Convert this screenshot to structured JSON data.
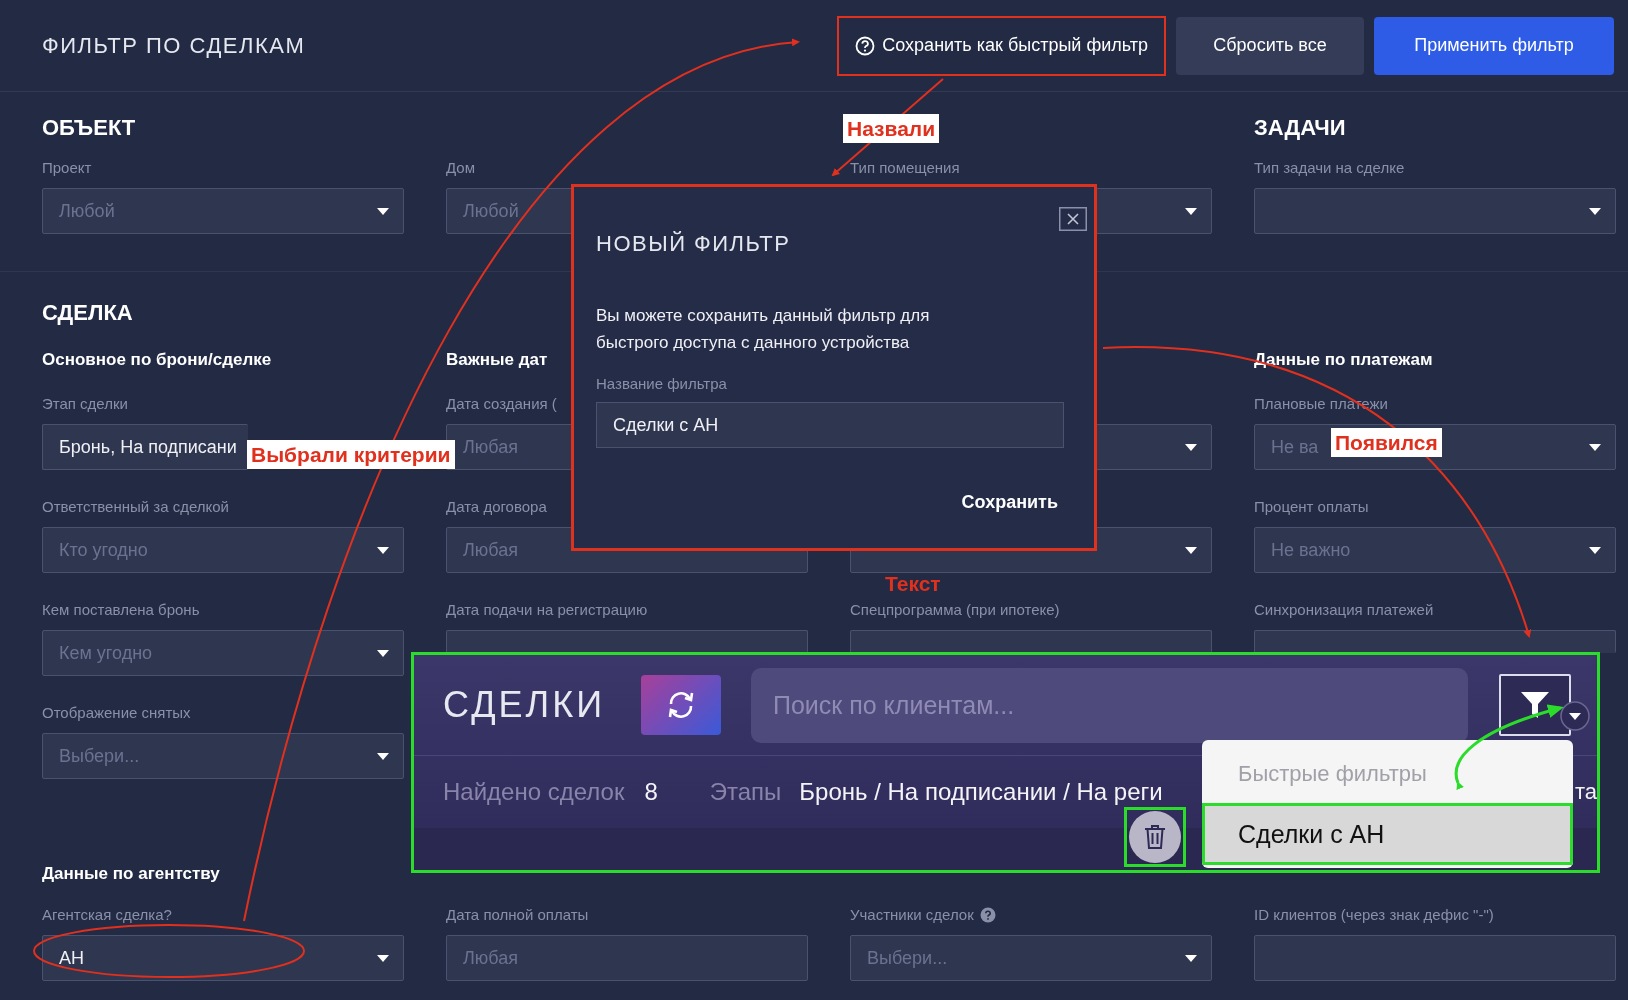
{
  "header": {
    "title": "ФИЛЬТР ПО СДЕЛКАМ",
    "buttons": [
      {
        "label": "Сохранить как быстрый фильтр",
        "kind": "quick"
      },
      {
        "label": "Сбросить все",
        "kind": "secondary"
      },
      {
        "label": "Применить фильтр",
        "kind": "primary"
      }
    ]
  },
  "object_section": {
    "columns": [
      {
        "heading": "ОБЪЕКТ",
        "fields": [
          {
            "label": "Проект",
            "placeholder": "Любой",
            "dropdown": true
          }
        ]
      },
      {
        "fields": [
          {
            "label": "Дом",
            "placeholder": "Любой"
          }
        ]
      },
      {
        "fields": [
          {
            "label": "Тип помещения",
            "dropdown": true
          }
        ]
      },
      {
        "heading": "ЗАДАЧИ",
        "fields": [
          {
            "label": "Тип задачи на сделке",
            "dropdown": true
          }
        ]
      }
    ]
  },
  "deal_section": {
    "title": "СДЕЛКА",
    "columns": [
      {
        "heading": "Основное по брони/сделке",
        "fields": [
          {
            "label": "Этап сделки",
            "value": "Бронь, На подписани",
            "dropdown": false
          },
          {
            "label": "Ответственный за сделкой",
            "placeholder": "Кто угодно",
            "dropdown": true
          },
          {
            "label": "Кем поставлена бронь",
            "placeholder": "Кем угодно",
            "dropdown": true
          },
          {
            "label": "Отображение снятых",
            "placeholder": "Выбери...",
            "dropdown": true
          }
        ]
      },
      {
        "heading": "Важные дат",
        "fields": [
          {
            "label": "Дата создания (",
            "placeholder": "Любая"
          },
          {
            "label": "Дата договора",
            "placeholder": "Любая"
          },
          {
            "label": "Дата подачи на регистрацию"
          }
        ]
      },
      {
        "fields": [
          {
            "dropdown": true
          },
          {
            "dropdown": true
          },
          {
            "label": "Спецпрограмма (при ипотеке)"
          }
        ]
      },
      {
        "heading": "Данные по платежам",
        "fields": [
          {
            "label": "Плановые платежи",
            "placeholder": "Не ва",
            "dropdown": true
          },
          {
            "label": "Процент оплаты",
            "placeholder": "Не важно",
            "dropdown": true
          },
          {
            "label": "Синхронизация платежей"
          }
        ]
      }
    ]
  },
  "agency": {
    "heading": "Данные по агентству",
    "fields": [
      {
        "label": "Агентская сделка?",
        "value": "АН",
        "dropdown": true
      },
      {
        "label": "Дата полной оплаты",
        "placeholder": "Любая",
        "dropdown": false
      },
      {
        "label": "Участники сделок",
        "help": true,
        "placeholder": "Выбери...",
        "dropdown": true
      },
      {
        "label": "ID клиентов (через знак дефис \"-\")",
        "dropdown": false
      }
    ]
  },
  "modal": {
    "title": "НОВЫЙ ФИЛЬТР",
    "text": "Вы можете сохранить данный фильтр для быстрого доступа с данного устройства",
    "field_label": "Название фильтра",
    "field_value": "Сделки с АН",
    "save": "Сохранить"
  },
  "inset": {
    "title": "СДЕЛКИ",
    "search_placeholder": "Поиск по клиентам...",
    "found_label": "Найдено сделок",
    "found_count": "8",
    "stages_label": "Этапы",
    "stages_value": "Бронь / На подписании / На реги",
    "stages_tail": "та",
    "quick_filters": {
      "heading": "Быстрые фильтры",
      "items": [
        {
          "label": "Сделки с АН",
          "selected": true
        }
      ]
    }
  },
  "annotations": [
    {
      "text": "Назвали",
      "kind": "label"
    },
    {
      "text": "Выбрали критерии",
      "kind": "label"
    },
    {
      "text": "Появился",
      "kind": "label"
    },
    {
      "text": "Текст",
      "kind": "plain"
    }
  ]
}
